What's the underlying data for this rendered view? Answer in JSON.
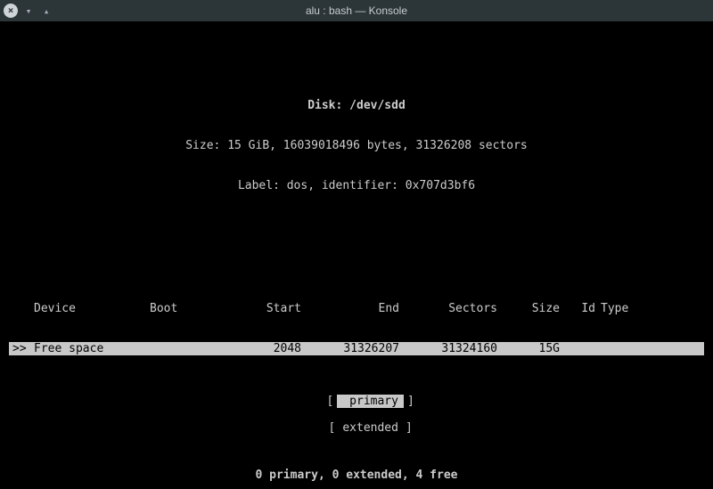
{
  "window": {
    "title": "alu : bash — Konsole"
  },
  "disk": {
    "line1": "Disk: /dev/sdd",
    "line2": "Size: 15 GiB, 16039018496 bytes, 31326208 sectors",
    "line3": "Label: dos, identifier: 0x707d3bf6"
  },
  "columns": {
    "device": "Device",
    "boot": "Boot",
    "start": "Start",
    "end": "End",
    "sectors": "Sectors",
    "size": "Size",
    "id": "Id",
    "type": "Type"
  },
  "rows": [
    {
      "pointer": ">>",
      "device": "Free space",
      "boot": "",
      "start": "2048",
      "end": "31326207",
      "sectors": "31324160",
      "size": "15G",
      "id": "",
      "type": ""
    }
  ],
  "menu": {
    "bracket_open": "[",
    "bracket_close": "]",
    "primary": " primary",
    "extended": "extended"
  },
  "status": "0 primary, 0 extended, 4 free"
}
